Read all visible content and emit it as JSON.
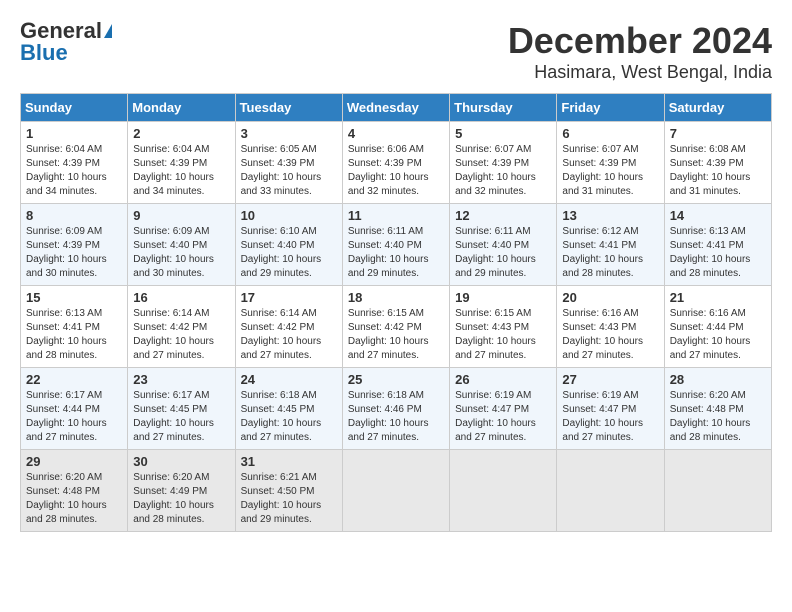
{
  "header": {
    "logo_general": "General",
    "logo_blue": "Blue",
    "title": "December 2024",
    "subtitle": "Hasimara, West Bengal, India"
  },
  "weekdays": [
    "Sunday",
    "Monday",
    "Tuesday",
    "Wednesday",
    "Thursday",
    "Friday",
    "Saturday"
  ],
  "weeks": [
    [
      {
        "day": "1",
        "info": "Sunrise: 6:04 AM\nSunset: 4:39 PM\nDaylight: 10 hours\nand 34 minutes."
      },
      {
        "day": "2",
        "info": "Sunrise: 6:04 AM\nSunset: 4:39 PM\nDaylight: 10 hours\nand 34 minutes."
      },
      {
        "day": "3",
        "info": "Sunrise: 6:05 AM\nSunset: 4:39 PM\nDaylight: 10 hours\nand 33 minutes."
      },
      {
        "day": "4",
        "info": "Sunrise: 6:06 AM\nSunset: 4:39 PM\nDaylight: 10 hours\nand 32 minutes."
      },
      {
        "day": "5",
        "info": "Sunrise: 6:07 AM\nSunset: 4:39 PM\nDaylight: 10 hours\nand 32 minutes."
      },
      {
        "day": "6",
        "info": "Sunrise: 6:07 AM\nSunset: 4:39 PM\nDaylight: 10 hours\nand 31 minutes."
      },
      {
        "day": "7",
        "info": "Sunrise: 6:08 AM\nSunset: 4:39 PM\nDaylight: 10 hours\nand 31 minutes."
      }
    ],
    [
      {
        "day": "8",
        "info": "Sunrise: 6:09 AM\nSunset: 4:39 PM\nDaylight: 10 hours\nand 30 minutes."
      },
      {
        "day": "9",
        "info": "Sunrise: 6:09 AM\nSunset: 4:40 PM\nDaylight: 10 hours\nand 30 minutes."
      },
      {
        "day": "10",
        "info": "Sunrise: 6:10 AM\nSunset: 4:40 PM\nDaylight: 10 hours\nand 29 minutes."
      },
      {
        "day": "11",
        "info": "Sunrise: 6:11 AM\nSunset: 4:40 PM\nDaylight: 10 hours\nand 29 minutes."
      },
      {
        "day": "12",
        "info": "Sunrise: 6:11 AM\nSunset: 4:40 PM\nDaylight: 10 hours\nand 29 minutes."
      },
      {
        "day": "13",
        "info": "Sunrise: 6:12 AM\nSunset: 4:41 PM\nDaylight: 10 hours\nand 28 minutes."
      },
      {
        "day": "14",
        "info": "Sunrise: 6:13 AM\nSunset: 4:41 PM\nDaylight: 10 hours\nand 28 minutes."
      }
    ],
    [
      {
        "day": "15",
        "info": "Sunrise: 6:13 AM\nSunset: 4:41 PM\nDaylight: 10 hours\nand 28 minutes."
      },
      {
        "day": "16",
        "info": "Sunrise: 6:14 AM\nSunset: 4:42 PM\nDaylight: 10 hours\nand 27 minutes."
      },
      {
        "day": "17",
        "info": "Sunrise: 6:14 AM\nSunset: 4:42 PM\nDaylight: 10 hours\nand 27 minutes."
      },
      {
        "day": "18",
        "info": "Sunrise: 6:15 AM\nSunset: 4:42 PM\nDaylight: 10 hours\nand 27 minutes."
      },
      {
        "day": "19",
        "info": "Sunrise: 6:15 AM\nSunset: 4:43 PM\nDaylight: 10 hours\nand 27 minutes."
      },
      {
        "day": "20",
        "info": "Sunrise: 6:16 AM\nSunset: 4:43 PM\nDaylight: 10 hours\nand 27 minutes."
      },
      {
        "day": "21",
        "info": "Sunrise: 6:16 AM\nSunset: 4:44 PM\nDaylight: 10 hours\nand 27 minutes."
      }
    ],
    [
      {
        "day": "22",
        "info": "Sunrise: 6:17 AM\nSunset: 4:44 PM\nDaylight: 10 hours\nand 27 minutes."
      },
      {
        "day": "23",
        "info": "Sunrise: 6:17 AM\nSunset: 4:45 PM\nDaylight: 10 hours\nand 27 minutes."
      },
      {
        "day": "24",
        "info": "Sunrise: 6:18 AM\nSunset: 4:45 PM\nDaylight: 10 hours\nand 27 minutes."
      },
      {
        "day": "25",
        "info": "Sunrise: 6:18 AM\nSunset: 4:46 PM\nDaylight: 10 hours\nand 27 minutes."
      },
      {
        "day": "26",
        "info": "Sunrise: 6:19 AM\nSunset: 4:47 PM\nDaylight: 10 hours\nand 27 minutes."
      },
      {
        "day": "27",
        "info": "Sunrise: 6:19 AM\nSunset: 4:47 PM\nDaylight: 10 hours\nand 27 minutes."
      },
      {
        "day": "28",
        "info": "Sunrise: 6:20 AM\nSunset: 4:48 PM\nDaylight: 10 hours\nand 28 minutes."
      }
    ],
    [
      {
        "day": "29",
        "info": "Sunrise: 6:20 AM\nSunset: 4:48 PM\nDaylight: 10 hours\nand 28 minutes."
      },
      {
        "day": "30",
        "info": "Sunrise: 6:20 AM\nSunset: 4:49 PM\nDaylight: 10 hours\nand 28 minutes."
      },
      {
        "day": "31",
        "info": "Sunrise: 6:21 AM\nSunset: 4:50 PM\nDaylight: 10 hours\nand 29 minutes."
      },
      null,
      null,
      null,
      null
    ]
  ]
}
